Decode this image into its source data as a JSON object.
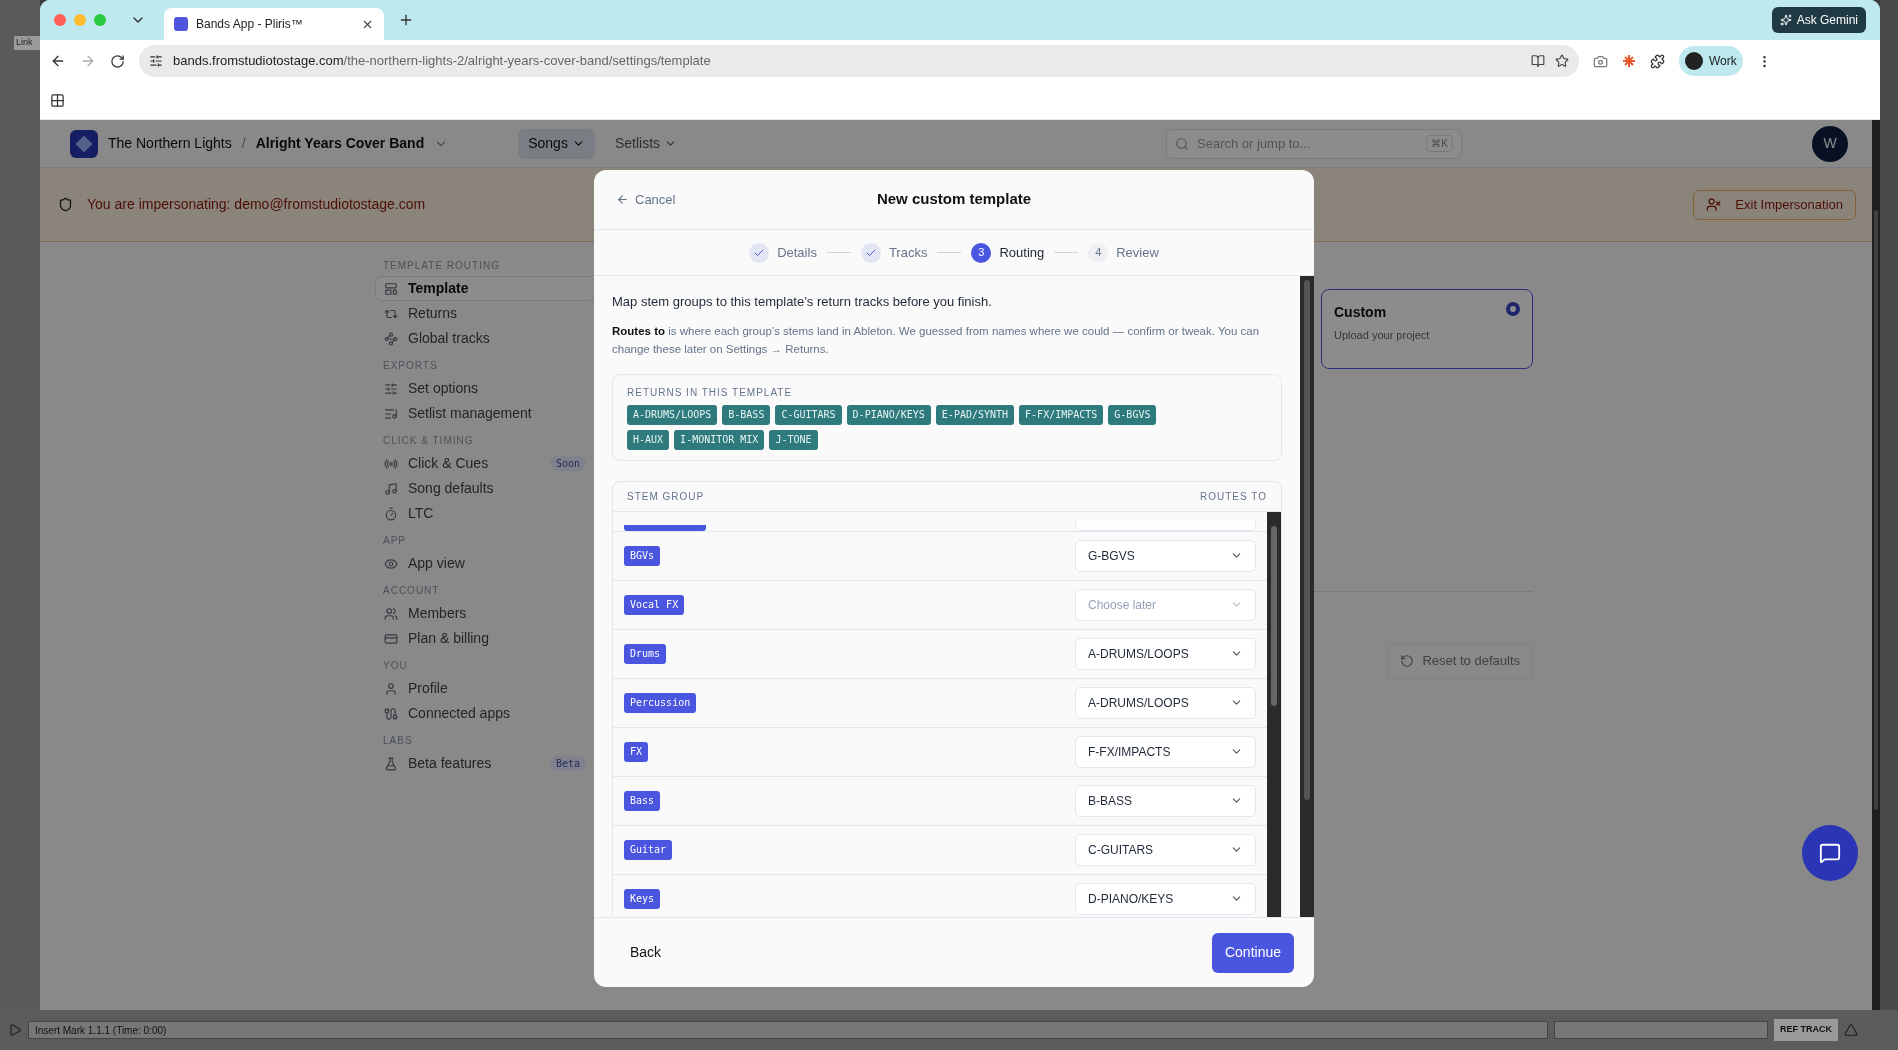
{
  "desktop": {
    "side_label": "Link",
    "status": "Insert Mark 1.1.1 (Time: 0:00)",
    "ref_track": "REF TRACK"
  },
  "browser": {
    "tab_title": "Bands App - Pliris™",
    "url_host": "bands.fromstudiotostage.com",
    "url_path": "/the-northern-lights-2/alright-years-cover-band/settings/template",
    "ask_button": "Ask Gemini",
    "profile": "Work"
  },
  "app_header": {
    "org": "The Northern Lights",
    "separator": "/",
    "band": "Alright Years Cover Band",
    "nav": [
      {
        "label": "Songs",
        "selected": true
      },
      {
        "label": "Setlists",
        "selected": false
      }
    ],
    "search": {
      "placeholder": "Search or jump to...",
      "shortcut": "⌘K"
    },
    "avatar": "W"
  },
  "banner": {
    "text": "You are impersonating: demo@fromstudiotostage.com",
    "button": "Exit Impersonation"
  },
  "sidebar": {
    "sections": [
      {
        "heading": "TEMPLATE ROUTING",
        "items": [
          {
            "label": "Template",
            "selected": true
          },
          {
            "label": "Returns",
            "selected": false
          },
          {
            "label": "Global tracks",
            "selected": false
          }
        ]
      },
      {
        "heading": "EXPORTS",
        "items": [
          {
            "label": "Set options",
            "selected": false
          },
          {
            "label": "Setlist management",
            "selected": false
          }
        ]
      },
      {
        "heading": "CLICK & TIMING",
        "items": [
          {
            "label": "Click & Cues",
            "selected": false,
            "badge": "Soon"
          },
          {
            "label": "Song defaults",
            "selected": false
          },
          {
            "label": "LTC",
            "selected": false
          }
        ]
      },
      {
        "heading": "APP",
        "items": [
          {
            "label": "App view",
            "selected": false
          }
        ]
      },
      {
        "heading": "ACCOUNT",
        "items": [
          {
            "label": "Members",
            "selected": false
          },
          {
            "label": "Plan & billing",
            "selected": false
          }
        ]
      },
      {
        "heading": "YOU",
        "items": [
          {
            "label": "Profile",
            "selected": false
          },
          {
            "label": "Connected apps",
            "selected": false
          }
        ]
      },
      {
        "heading": "LABS",
        "items": [
          {
            "label": "Beta features",
            "selected": false,
            "badge": "Beta"
          }
        ]
      }
    ]
  },
  "template_card": {
    "title": "Custom",
    "subtitle": "Upload your project",
    "selected": true
  },
  "reset_button": "Reset to defaults",
  "modal": {
    "cancel": "Cancel",
    "title": "New custom template",
    "steps": [
      {
        "label": "Details",
        "done": true,
        "selected": false
      },
      {
        "label": "Tracks",
        "done": true,
        "selected": false
      },
      {
        "number": "3",
        "label": "Routing",
        "done": false,
        "selected": true
      },
      {
        "number": "4",
        "label": "Review",
        "done": false,
        "selected": false
      }
    ],
    "intro": "Map stem groups to this template’s return tracks before you finish.",
    "note": "**Routes to** is where each group’s stems land in Ableton. We guessed from names where we could — confirm or tweak. You can change these later on Settings → Returns.",
    "returns": {
      "heading": "RETURNS IN THIS TEMPLATE",
      "tags": [
        "A-DRUMS/LOOPS",
        "B-BASS",
        "C-GUITARS",
        "D-PIANO/KEYS",
        "E-PAD/SYNTH",
        "F-FX/IMPACTS",
        "G-BGVS",
        "H-AUX",
        "I-MONITOR MIX",
        "J-TONE"
      ]
    },
    "table": {
      "columns": [
        "STEM GROUP",
        "ROUTES TO"
      ],
      "rows": [
        {
          "group": "BGVs",
          "route": "G-BGVS",
          "chosen": true
        },
        {
          "group": "Vocal FX",
          "route": "Choose later",
          "chosen": false
        },
        {
          "group": "Drums",
          "route": "A-DRUMS/LOOPS",
          "chosen": true
        },
        {
          "group": "Percussion",
          "route": "A-DRUMS/LOOPS",
          "chosen": true
        },
        {
          "group": "FX",
          "route": "F-FX/IMPACTS",
          "chosen": true
        },
        {
          "group": "Bass",
          "route": "B-BASS",
          "chosen": true
        },
        {
          "group": "Guitar",
          "route": "C-GUITARS",
          "chosen": true
        },
        {
          "group": "Keys",
          "route": "D-PIANO/KEYS",
          "chosen": true
        }
      ]
    },
    "back": "Back",
    "continue": "Continue"
  }
}
